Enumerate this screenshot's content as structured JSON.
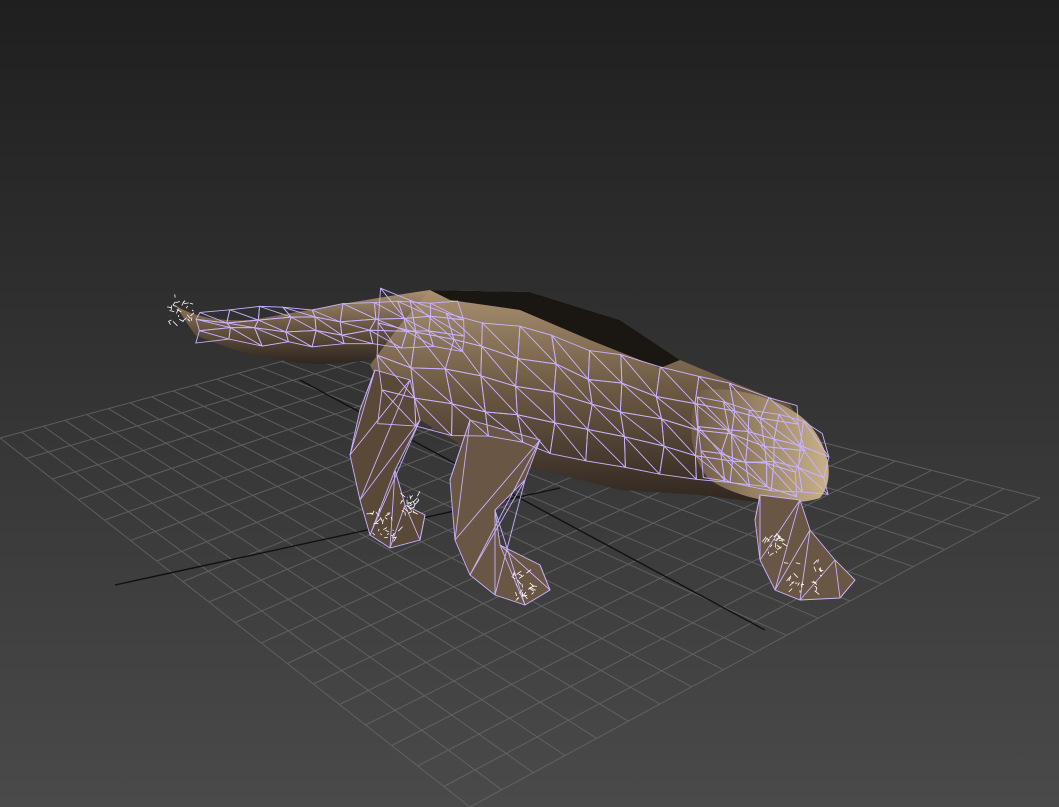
{
  "viewport": {
    "background_top": "#1f1f1f",
    "background_bottom": "#4a4a4a",
    "grid_color": "#6a6a6a",
    "axis_color": "#111111"
  },
  "model": {
    "subject": "lizard",
    "skin_color_light": "#a89070",
    "skin_color_mid": "#6e5a44",
    "skin_color_dark": "#2e2620",
    "wireframe_color": "#c9b3ff",
    "vertex_color": "#ffffff",
    "selected": true
  }
}
